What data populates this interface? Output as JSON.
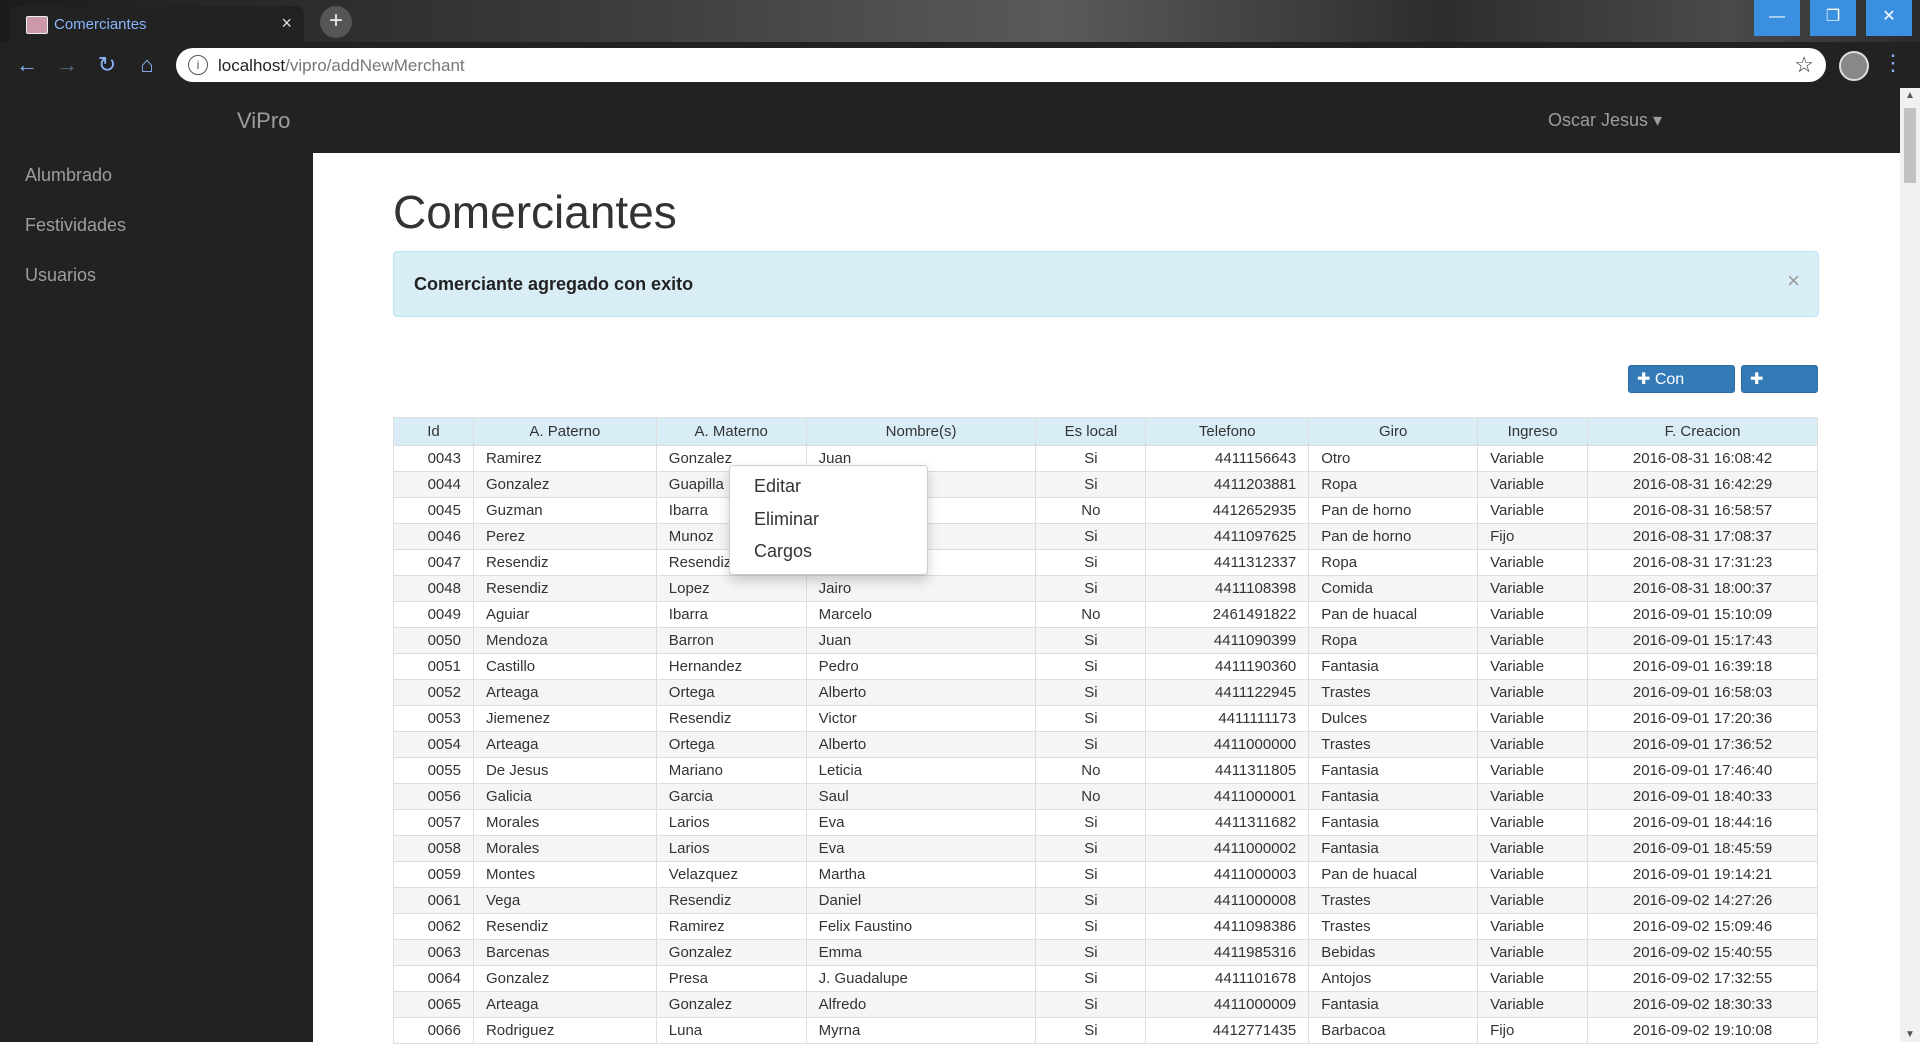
{
  "browser": {
    "tab_title": "Comerciantes",
    "tab_close": "×",
    "new_tab": "+",
    "url_host": "localhost",
    "url_path": "/vipro/addNewMerchant",
    "win_min": "—",
    "win_restore": "❐",
    "win_close": "✕"
  },
  "nav": {
    "brand": "ViPro",
    "user": "Oscar Jesus ▾"
  },
  "sidebar": {
    "items": [
      {
        "label": "Alumbrado"
      },
      {
        "label": "Festividades"
      },
      {
        "label": "Usuarios"
      }
    ]
  },
  "page": {
    "title": "Comerciantes",
    "alert": "Comerciante agregado con exito",
    "alert_close": "×",
    "btn_con_recibo": "✚ Con recibo",
    "btn_nuevo": "✚ Nuevo"
  },
  "table": {
    "headers": [
      "Id",
      "A. Paterno",
      "A. Materno",
      "Nombre(s)",
      "Es local",
      "Telefono",
      "Giro",
      "Ingreso",
      "F. Creacion"
    ],
    "rows": [
      [
        "0043",
        "Ramirez",
        "Gonzalez",
        "Juan",
        "Si",
        "4411156643",
        "Otro",
        "Variable",
        "2016-08-31 16:08:42"
      ],
      [
        "0044",
        "Gonzalez",
        "Guapilla",
        "",
        "Si",
        "4411203881",
        "Ropa",
        "Variable",
        "2016-08-31 16:42:29"
      ],
      [
        "0045",
        "Guzman",
        "Ibarra",
        "",
        "No",
        "4412652935",
        "Pan de horno",
        "Variable",
        "2016-08-31 16:58:57"
      ],
      [
        "0046",
        "Perez",
        "Munoz",
        "",
        "Si",
        "4411097625",
        "Pan de horno",
        "Fijo",
        "2016-08-31 17:08:37"
      ],
      [
        "0047",
        "Resendiz",
        "Resendiz",
        "",
        "Si",
        "4411312337",
        "Ropa",
        "Variable",
        "2016-08-31 17:31:23"
      ],
      [
        "0048",
        "Resendiz",
        "Lopez",
        "Jairo",
        "Si",
        "4411108398",
        "Comida",
        "Variable",
        "2016-08-31 18:00:37"
      ],
      [
        "0049",
        "Aguiar",
        "Ibarra",
        "Marcelo",
        "No",
        "2461491822",
        "Pan de huacal",
        "Variable",
        "2016-09-01 15:10:09"
      ],
      [
        "0050",
        "Mendoza",
        "Barron",
        "Juan",
        "Si",
        "4411090399",
        "Ropa",
        "Variable",
        "2016-09-01 15:17:43"
      ],
      [
        "0051",
        "Castillo",
        "Hernandez",
        "Pedro",
        "Si",
        "4411190360",
        "Fantasia",
        "Variable",
        "2016-09-01 16:39:18"
      ],
      [
        "0052",
        "Arteaga",
        "Ortega",
        "Alberto",
        "Si",
        "4411122945",
        "Trastes",
        "Variable",
        "2016-09-01 16:58:03"
      ],
      [
        "0053",
        "Jiemenez",
        "Resendiz",
        "Victor",
        "Si",
        "4411111173",
        "Dulces",
        "Variable",
        "2016-09-01 17:20:36"
      ],
      [
        "0054",
        "Arteaga",
        "Ortega",
        "Alberto",
        "Si",
        "4411000000",
        "Trastes",
        "Variable",
        "2016-09-01 17:36:52"
      ],
      [
        "0055",
        "De Jesus",
        "Mariano",
        "Leticia",
        "No",
        "4411311805",
        "Fantasia",
        "Variable",
        "2016-09-01 17:46:40"
      ],
      [
        "0056",
        "Galicia",
        "Garcia",
        "Saul",
        "No",
        "4411000001",
        "Fantasia",
        "Variable",
        "2016-09-01 18:40:33"
      ],
      [
        "0057",
        "Morales",
        "Larios",
        "Eva",
        "Si",
        "4411311682",
        "Fantasia",
        "Variable",
        "2016-09-01 18:44:16"
      ],
      [
        "0058",
        "Morales",
        "Larios",
        "Eva",
        "Si",
        "4411000002",
        "Fantasia",
        "Variable",
        "2016-09-01 18:45:59"
      ],
      [
        "0059",
        "Montes",
        "Velazquez",
        "Martha",
        "Si",
        "4411000003",
        "Pan de huacal",
        "Variable",
        "2016-09-01 19:14:21"
      ],
      [
        "0061",
        "Vega",
        "Resendiz",
        "Daniel",
        "Si",
        "4411000008",
        "Trastes",
        "Variable",
        "2016-09-02 14:27:26"
      ],
      [
        "0062",
        "Resendiz",
        "Ramirez",
        "Felix Faustino",
        "Si",
        "4411098386",
        "Trastes",
        "Variable",
        "2016-09-02 15:09:46"
      ],
      [
        "0063",
        "Barcenas",
        "Gonzalez",
        "Emma",
        "Si",
        "4411985316",
        "Bebidas",
        "Variable",
        "2016-09-02 15:40:55"
      ],
      [
        "0064",
        "Gonzalez",
        "Presa",
        "J. Guadalupe",
        "Si",
        "4411101678",
        "Antojos",
        "Variable",
        "2016-09-02 17:32:55"
      ],
      [
        "0065",
        "Arteaga",
        "Gonzalez",
        "Alfredo",
        "Si",
        "4411000009",
        "Fantasia",
        "Variable",
        "2016-09-02 18:30:33"
      ],
      [
        "0066",
        "Rodriguez",
        "Luna",
        "Myrna",
        "Si",
        "4412771435",
        "Barbacoa",
        "Fijo",
        "2016-09-02 19:10:08"
      ]
    ]
  },
  "context_menu": {
    "items": [
      "Editar",
      "Eliminar",
      "Cargos"
    ]
  }
}
